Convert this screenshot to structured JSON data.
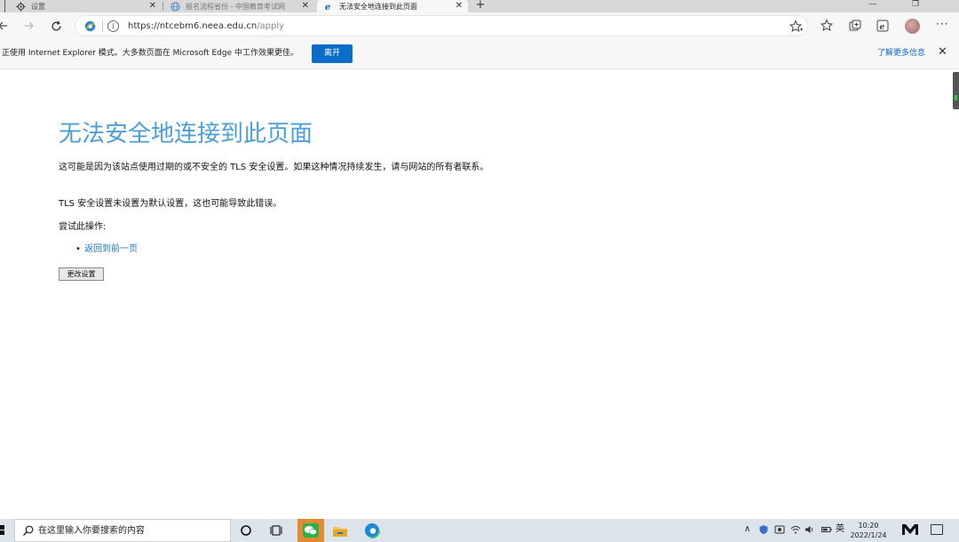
{
  "browser": {
    "tabs": [
      {
        "title": "设置",
        "icon": "gear-icon",
        "active": false
      },
      {
        "title": "报名流程省份 - 中国教育考试网",
        "icon": "globe-icon",
        "active": false
      },
      {
        "title": "无法安全地连接到此页面",
        "icon": "ie-icon",
        "active": true
      }
    ],
    "new_tab": "+",
    "window_controls": {
      "minimize": "—",
      "maximize": "❐"
    },
    "address": {
      "host": "https://ntcebm6.neea.edu.cn",
      "path": "/apply"
    },
    "ie_bar": {
      "message": "正使用 Internet Explorer 模式。大多数页面在 Microsoft Edge 中工作效果更佳。",
      "button": "离开",
      "learn_more": "了解更多信息",
      "close": "✕"
    }
  },
  "page": {
    "title": "无法安全地连接到此页面",
    "para1": "这可能是因为该站点使用过期的或不安全的 TLS 安全设置。如果这种情况持续发生，请与网站的所有者联系。",
    "para2": "TLS 安全设置未设置为默认设置，这也可能导致此错误。",
    "try_heading": "尝试此操作:",
    "links": [
      "返回到前一页"
    ],
    "change_settings_button": "更改设置"
  },
  "taskbar": {
    "search_placeholder": "在这里输入你要搜索的内容",
    "tray": {
      "language": "英",
      "time": "10:20",
      "date": "2022/1/24"
    },
    "apps": [
      "cortana-icon",
      "task-view-icon",
      "wechat-icon",
      "file-explorer-icon",
      "edge-icon"
    ]
  },
  "colors": {
    "accent": "#0b6cc9",
    "title_blue": "#4a9fd8",
    "link_blue": "#1a73c8",
    "wechat_bg": "#e58a31"
  }
}
